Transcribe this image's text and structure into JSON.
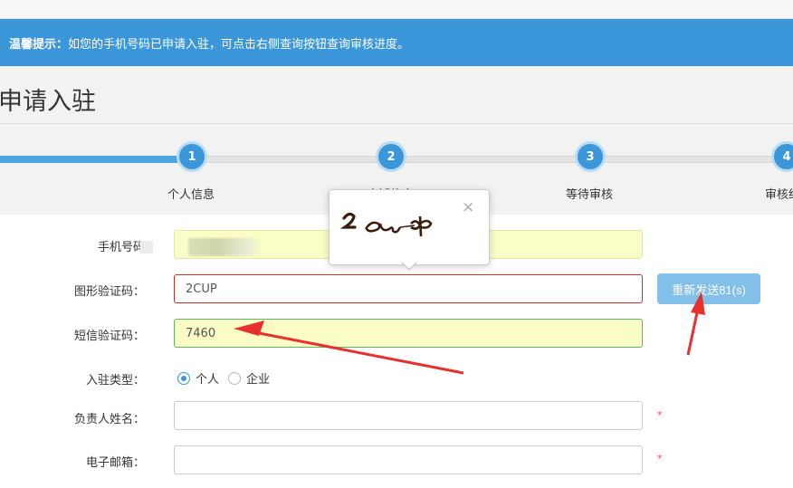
{
  "notice": {
    "label": "温馨提示：",
    "text": "如您的手机号码已申请入驻，可点击右侧查询按钮查询审核进度。"
  },
  "page": {
    "title": "申请入驻"
  },
  "steps": [
    {
      "number": "1",
      "label": "个人信息"
    },
    {
      "number": "2",
      "label": "店铺信息"
    },
    {
      "number": "3",
      "label": "等待审核"
    },
    {
      "number": "4",
      "label": "审核结果"
    }
  ],
  "form": {
    "phone": {
      "label": "手机号码"
    },
    "captcha": {
      "label": "图形验证码：",
      "value": "2CUP"
    },
    "sms": {
      "label": "短信验证码：",
      "value": "7460"
    },
    "type": {
      "label": "入驻类型：",
      "options": [
        "个人",
        "企业"
      ],
      "selected": "个人"
    },
    "name": {
      "label": "负责人姓名：",
      "required_mark": "*"
    },
    "email": {
      "label": "电子邮箱：",
      "required_mark": "*"
    },
    "resend_button": "重新发送81(s)"
  },
  "popover": {
    "close": "×",
    "captcha_text": "2 CUP"
  },
  "colors": {
    "accent": "#3b97da",
    "arrow": "#e8312f",
    "required": "#d9534f"
  }
}
